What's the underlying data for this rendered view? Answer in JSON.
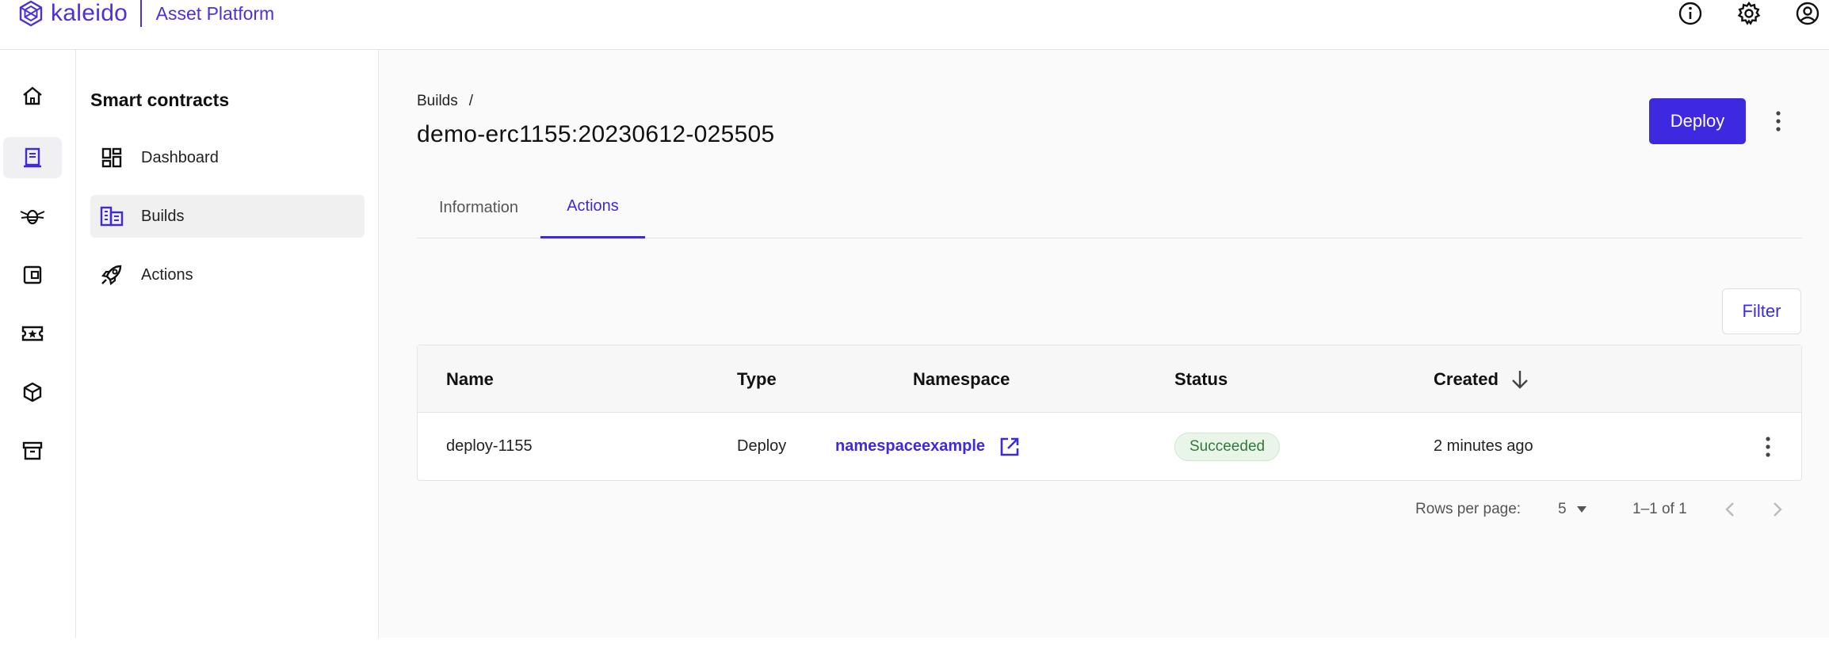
{
  "brand": {
    "logo_text": "kaleido",
    "product": "Asset Platform",
    "accent": "#3d2ae0"
  },
  "topbar": {
    "icons": [
      "info-icon",
      "gear-icon",
      "account-icon"
    ]
  },
  "rail": {
    "items": [
      {
        "icon": "home-icon"
      },
      {
        "icon": "contract-icon",
        "active": true
      },
      {
        "icon": "bee-icon"
      },
      {
        "icon": "wallet-icon"
      },
      {
        "icon": "ticket-star-icon"
      },
      {
        "icon": "cube-icon"
      },
      {
        "icon": "archive-icon"
      }
    ]
  },
  "sidenav": {
    "title": "Smart contracts",
    "items": [
      {
        "label": "Dashboard",
        "icon": "dashboard-icon"
      },
      {
        "label": "Builds",
        "icon": "builds-icon",
        "active": true
      },
      {
        "label": "Actions",
        "icon": "rocket-icon"
      }
    ]
  },
  "main": {
    "breadcrumb": {
      "parent": "Builds",
      "separator": "/"
    },
    "title": "demo-erc1155:20230612-025505",
    "deploy_label": "Deploy",
    "tabs": [
      {
        "label": "Information"
      },
      {
        "label": "Actions",
        "active": true
      }
    ],
    "filter_label": "Filter",
    "table": {
      "columns": [
        "Name",
        "Type",
        "Namespace",
        "Status",
        "Created"
      ],
      "rows": [
        {
          "name": "deploy-1155",
          "type": "Deploy",
          "namespace": "namespaceexample",
          "status": "Succeeded",
          "created": "2 minutes ago"
        }
      ]
    },
    "pagination": {
      "rows_label": "Rows per page:",
      "rows_value": "5",
      "range": "1–1 of 1"
    }
  }
}
